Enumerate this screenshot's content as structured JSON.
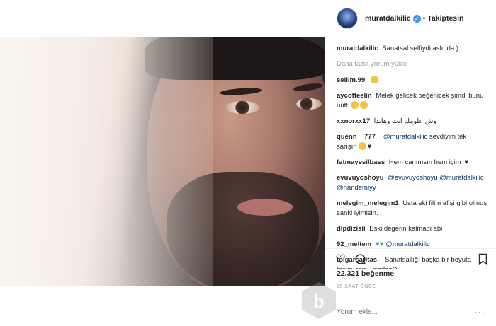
{
  "post": {
    "username": "muratdalkilic",
    "follow_status": "Takiptesin",
    "caption_user": "muratdalkilic",
    "caption": "Sanatsal selfiydi aslında:)",
    "load_more": "Daha fazla yorum yükle",
    "likes": "22.321 beğenme",
    "time": "15 SAAT ÖNCE",
    "comment_placeholder": "Yorum ekle...",
    "more_options": "···"
  },
  "comments": [
    {
      "user": "seliim.99",
      "text": ""
    },
    {
      "user": "aycoffeelin",
      "text": "Melek gelicek beğenicek şimdi bunu üüff"
    },
    {
      "user": "xxnorxx17",
      "text": "وش علومك انت وهاتدا"
    },
    {
      "user": "quenn__777_",
      "mention": "@muratdalkilic",
      "text": "sevdiyim tek sarışın"
    },
    {
      "user": "fatmayesilbass",
      "text": "Hem canımsın hem içim"
    },
    {
      "user": "evuvuyoshoyu",
      "mention": "@evuvuyoshoyu",
      "mention2": "@muratdalkilic",
      "mention3": "@handemiyy"
    },
    {
      "user": "melegim_melegim1",
      "text": "Usta eki filim afişi gibi olmuş sanki iyimisin."
    },
    {
      "user": "dipdizisii",
      "text": "Eski degerin kalmadi abi"
    },
    {
      "user": "92_meltem",
      "mention": "@muratdalkilic"
    },
    {
      "user": "tolgarsaritas_",
      "text": "Sanatsallığı başka bir boyuta taşımışsın.. sizdenD"
    }
  ],
  "icons": {
    "like": "heart-icon",
    "comment": "comment-icon",
    "bookmark": "bookmark-icon",
    "verified": "verified-badge-icon"
  },
  "colors": {
    "text": "#262626",
    "muted": "#999999",
    "link": "#003569",
    "verified": "#3897f0",
    "border": "#efefef"
  }
}
